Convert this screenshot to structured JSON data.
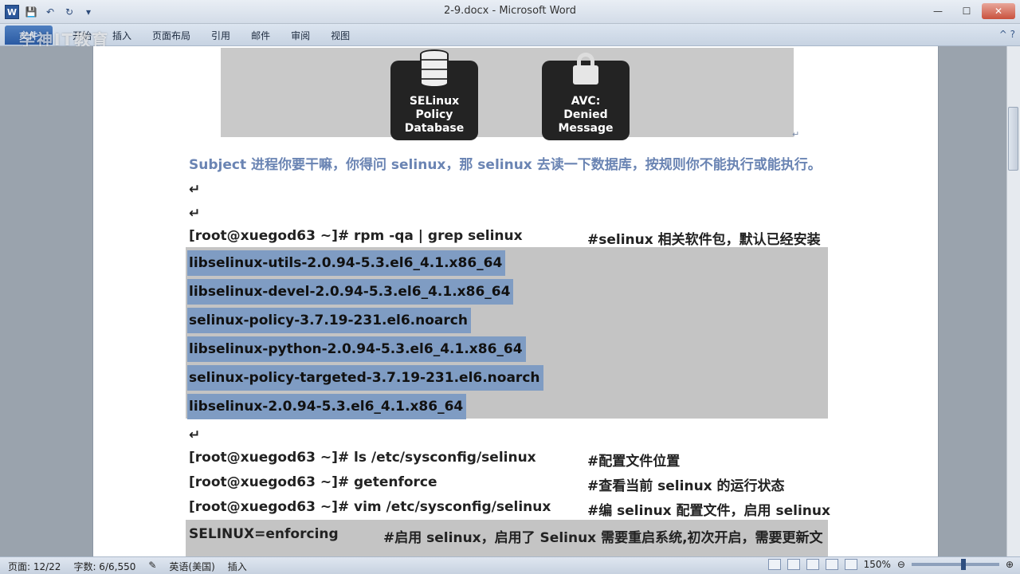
{
  "window": {
    "title": "2-9.docx - Microsoft Word",
    "minimize": "—",
    "maximize": "☐",
    "close": "✕"
  },
  "qat": {
    "logo": "W",
    "save": "💾",
    "undo": "↶",
    "redo": "↻",
    "more": "▾"
  },
  "ribbon": {
    "file_tab": "文件",
    "tabs": [
      "开始",
      "插入",
      "页面布局",
      "引用",
      "邮件",
      "审阅",
      "视图"
    ],
    "help": "^ ?",
    "watermark": "学神IT教育"
  },
  "document": {
    "image_cards": [
      {
        "text": "SELinux\nPolicy\nDatabase",
        "icon": "database-icon"
      },
      {
        "text": "AVC:\nDenied\nMessage",
        "icon": "lock-icon"
      }
    ],
    "subject_line": "Subject 进程你要干嘛，你得问 selinux，那 selinux 去读一下数据库，按规则你不能执行或能执行。",
    "command_1": {
      "prompt": "[root@xuegod63 ~]# rpm -qa | grep selinux",
      "comment": "#selinux 相关软件包，默认已经安装"
    },
    "packages": [
      "libselinux-utils-2.0.94-5.3.el6_4.1.x86_64",
      "libselinux-devel-2.0.94-5.3.el6_4.1.x86_64",
      "selinux-policy-3.7.19-231.el6.noarch",
      "libselinux-python-2.0.94-5.3.el6_4.1.x86_64",
      "selinux-policy-targeted-3.7.19-231.el6.noarch",
      "libselinux-2.0.94-5.3.el6_4.1.x86_64"
    ],
    "command_2": {
      "prompt": "[root@xuegod63 ~]# ls /etc/sysconfig/selinux",
      "comment": "#配置文件位置"
    },
    "command_3": {
      "prompt": "[root@xuegod63 ~]# getenforce",
      "comment": "#查看当前 selinux 的运行状态"
    },
    "command_4": {
      "prompt": "[root@xuegod63 ~]# vim /etc/sysconfig/selinux",
      "comment": "#编 selinux 配置文件，启用 selinux"
    },
    "config_line": {
      "setting": "SELINUX=enforcing",
      "comment": "#启用 selinux，启用了 Selinux 需要重启系统,初次开启，需要更新文"
    },
    "paragraph_mark": "↵"
  },
  "statusbar": {
    "page": "页面: 12/22",
    "words": "字数: 6/6,550",
    "language": "英语(美国)",
    "mode": "插入",
    "zoom": "150%",
    "zoom_out": "⊖",
    "zoom_in": "⊕"
  }
}
